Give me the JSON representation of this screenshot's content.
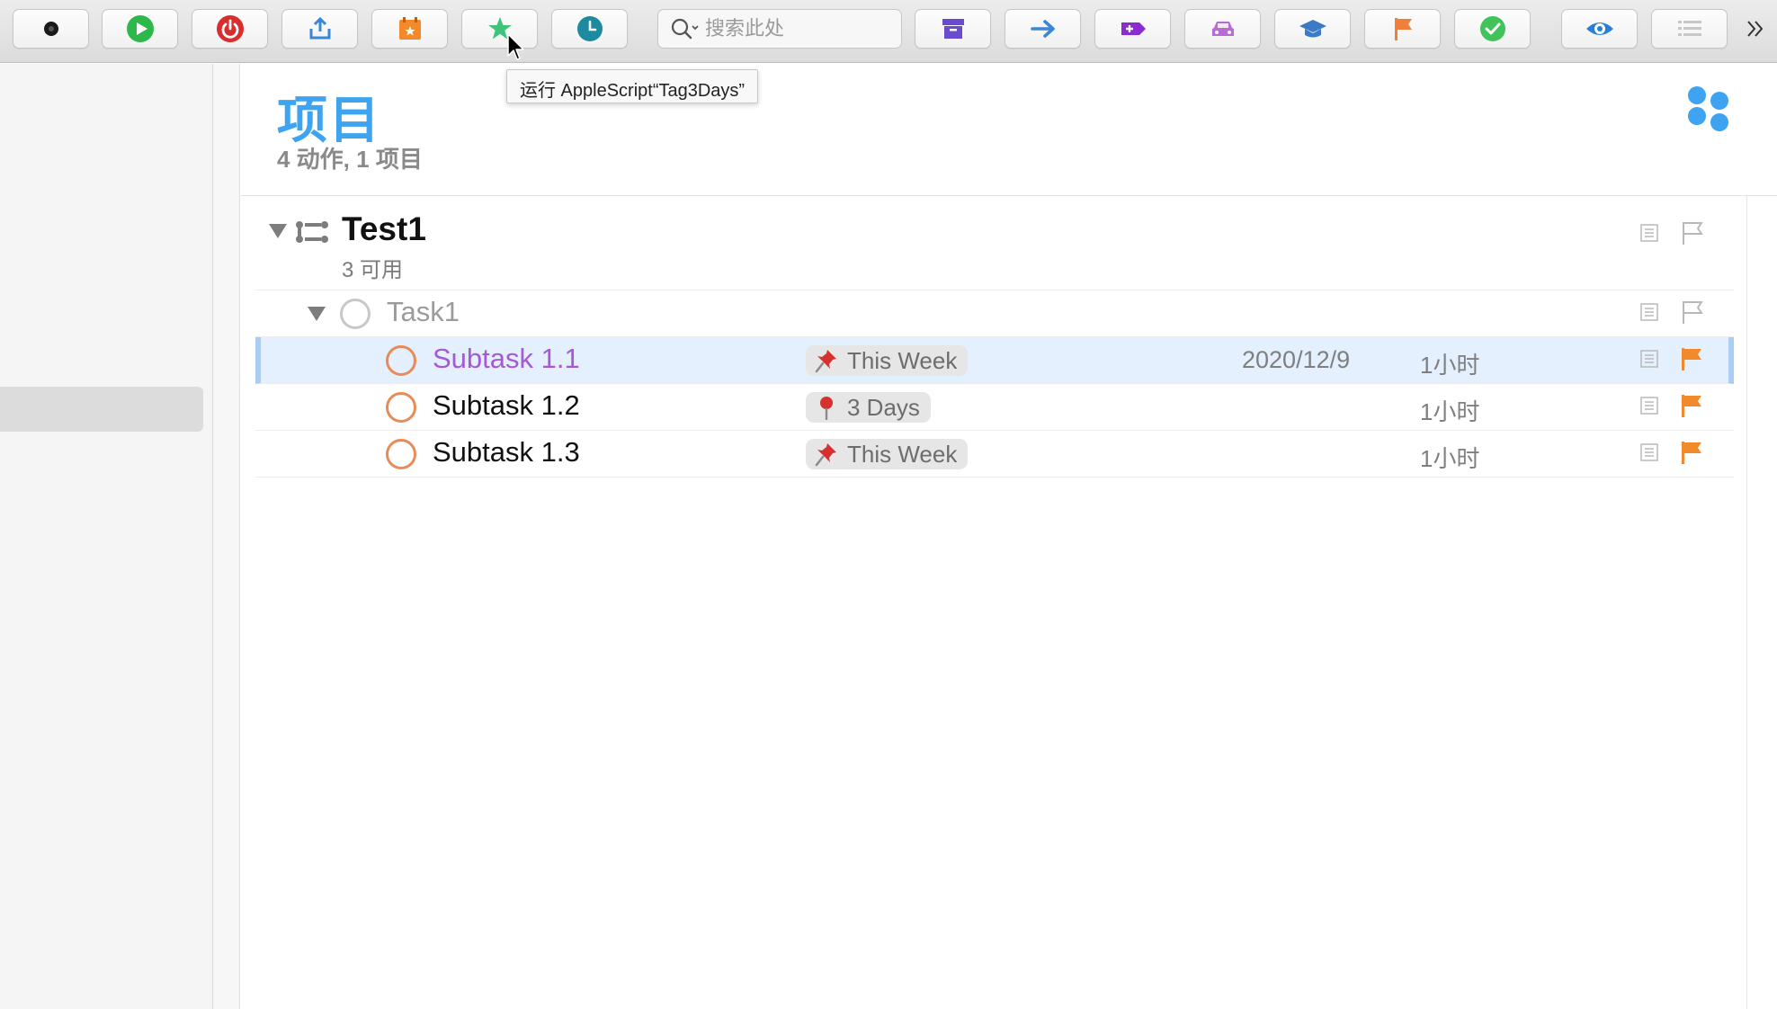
{
  "toolbar": {
    "search": {
      "placeholder": "搜索此处"
    },
    "buttons": [
      {
        "name": "record-button",
        "icon": "dot-icon",
        "color": "#1a1a1a"
      },
      {
        "name": "play-button",
        "icon": "play-icon",
        "color": "#2eb84b"
      },
      {
        "name": "power-button",
        "icon": "power-icon",
        "color": "#d92e2e"
      },
      {
        "name": "share-button",
        "icon": "share-icon",
        "color": "#3a87d6"
      },
      {
        "name": "calendar-button",
        "icon": "calendar-icon",
        "color": "#f28a2a"
      },
      {
        "name": "star-button",
        "icon": "star-icon",
        "color": "#3fc37a"
      },
      {
        "name": "clock-button",
        "icon": "clock-icon",
        "color": "#1d8aa0"
      },
      {
        "name": "archive-button",
        "icon": "archive-icon",
        "color": "#6a4bcf"
      },
      {
        "name": "arrow-button",
        "icon": "arrow-right-icon",
        "color": "#3a87d6"
      },
      {
        "name": "tag-button",
        "icon": "tag-icon",
        "color": "#8a2ccf"
      },
      {
        "name": "car-button",
        "icon": "car-icon",
        "color": "#b86ad6"
      },
      {
        "name": "graduation-button",
        "icon": "graduation-cap-icon",
        "color": "#3a7ac6"
      },
      {
        "name": "flag-button",
        "icon": "flag-icon",
        "color": "#f07f3a"
      },
      {
        "name": "complete-button",
        "icon": "checkmark-icon",
        "color": "#3fc35a"
      },
      {
        "name": "view-button",
        "icon": "eye-icon",
        "color": "#2a7fd6"
      },
      {
        "name": "list-button",
        "icon": "list-icon",
        "color": "#c8c8c8"
      }
    ],
    "overflow_label": "»"
  },
  "tooltip": {
    "text": "运行 AppleScript“Tag3Days”"
  },
  "header": {
    "title": "项目",
    "subtitle": "4 动作, 1 项目",
    "accent": "#3ea3f0"
  },
  "project": {
    "name": "Test1",
    "meta": "3 可用"
  },
  "task": {
    "name": "Task1"
  },
  "subtasks": [
    {
      "name": "Subtask 1.1",
      "tag": "This Week",
      "tag_icon": "pushpin-icon",
      "date": "2020/12/9",
      "duration": "1小时",
      "flagged": true,
      "selected": true
    },
    {
      "name": "Subtask 1.2",
      "tag": "3 Days",
      "tag_icon": "round-pin-icon",
      "date": "",
      "duration": "1小时",
      "flagged": true,
      "selected": false
    },
    {
      "name": "Subtask 1.3",
      "tag": "This Week",
      "tag_icon": "pushpin-icon",
      "date": "",
      "duration": "1小时",
      "flagged": true,
      "selected": false
    }
  ],
  "colors": {
    "flag": "#f08a2a",
    "check_orange": "#e88b5a",
    "selected_name": "#a45ad6",
    "selection_bg": "#e4f0fd"
  }
}
